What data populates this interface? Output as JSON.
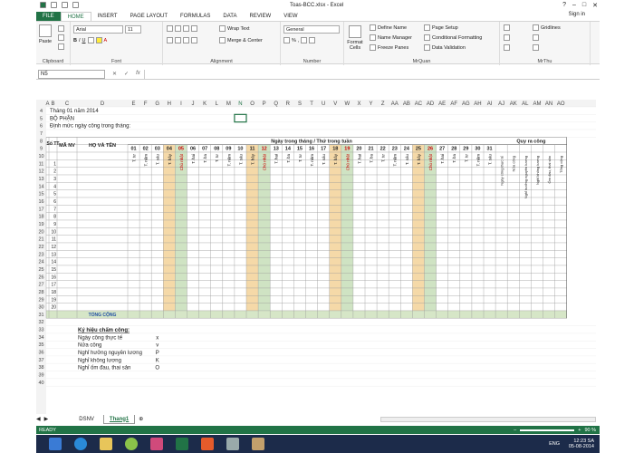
{
  "window": {
    "title": "Toas-BCC.xlsx - Excel",
    "signin": "Sign in"
  },
  "tabs": [
    "FILE",
    "HOME",
    "INSERT",
    "PAGE LAYOUT",
    "FORMULAS",
    "DATA",
    "REVIEW",
    "VIEW"
  ],
  "ribbon": {
    "paste": "Paste",
    "clipboard": "Clipboard",
    "font_name": "Arial",
    "font_size": "11",
    "font": "Font",
    "wrap": "Wrap Text",
    "merge": "Merge & Center",
    "alignment": "Alignment",
    "number_format": "General",
    "number": "Number",
    "format_cells": "Format Cells",
    "define_name": "Define Name",
    "name_manager": "Name Manager",
    "freeze": "Freeze Panes",
    "page_setup": "Page Setup",
    "cond_format": "Conditional Formatting",
    "data_validation": "Data Validation",
    "mrquan": "MrQuan",
    "gridlines": "Gridlines",
    "mrthu": "MrThu"
  },
  "name_box": "N5",
  "columns": [
    "A",
    "B",
    "C",
    "D",
    "E",
    "F",
    "G",
    "H",
    "I",
    "J",
    "K",
    "L",
    "M",
    "N",
    "O",
    "P",
    "Q",
    "R",
    "S",
    "T",
    "U",
    "V",
    "W",
    "X",
    "Y",
    "Z",
    "AA",
    "AB",
    "AC",
    "AD",
    "AE",
    "AF",
    "AG",
    "AH",
    "AI",
    "AJ",
    "AK",
    "AL",
    "AM",
    "AN",
    "AO"
  ],
  "sheet": {
    "r4": "Tháng 01 năm 2014",
    "r5": "BỘ PHẬN",
    "r6": "Định mức ngày công trong tháng:",
    "group_days": "Ngày trong tháng / Thứ trong tuần",
    "group_qr": "Quy ra công",
    "stt": "Số TT",
    "manv": "MÃ NV",
    "hoten": "HỌ VÀ TÊN",
    "days": [
      "01",
      "02",
      "03",
      "04",
      "05",
      "06",
      "07",
      "08",
      "09",
      "10",
      "11",
      "12",
      "13",
      "14",
      "15",
      "16",
      "17",
      "18",
      "19",
      "20",
      "21",
      "22",
      "23",
      "24",
      "25",
      "26",
      "27",
      "28",
      "29",
      "30",
      "31"
    ],
    "weekdays": [
      "T. tư",
      "T. năm",
      "T. sáu",
      "T. bảy",
      "Chủ nhật",
      "T. hai",
      "T. ba",
      "T. tư",
      "T. năm",
      "T. sáu",
      "T. bảy",
      "Chủ nhật",
      "T. hai",
      "T. ba",
      "T. tư",
      "T. năm",
      "T. sáu",
      "T. bảy",
      "Chủ nhật",
      "T. hai",
      "T. ba",
      "T. tư",
      "T. năm",
      "T. sáu",
      "T. bảy",
      "Chủ nhật",
      "T. hai",
      "T. ba",
      "T. tư",
      "T. năm",
      "T. sáu"
    ],
    "qr": [
      "Ngày công thực tế",
      "Nửa công",
      "Nghỉ hưởng nguyên lương",
      "Nghỉ không lương",
      "Ốm đau, thai sản",
      "Tổng cộng"
    ],
    "total": "TỔNG CỘNG",
    "legend_title": "Ký hiệu chấm công:",
    "legend": [
      [
        "Ngày công thực tế",
        "x"
      ],
      [
        "Nửa công",
        "v"
      ],
      [
        "Nghỉ hưởng nguyên lương",
        "P"
      ],
      [
        "Nghỉ không lương",
        "K"
      ],
      [
        "Nghỉ ốm đau, thai sản",
        "O"
      ]
    ]
  },
  "sheet_tabs": [
    "DSNV",
    "Thang1"
  ],
  "status": {
    "ready": "READY",
    "zoom": "90 %"
  },
  "tray": {
    "lang": "ENG",
    "time": "12:23 SA",
    "date": "05-08-2014"
  },
  "colors": {
    "excel": "#217346",
    "weekend": "#f5d9a8",
    "sunday": "#cfe3c3",
    "total": "#d6e6c7"
  }
}
